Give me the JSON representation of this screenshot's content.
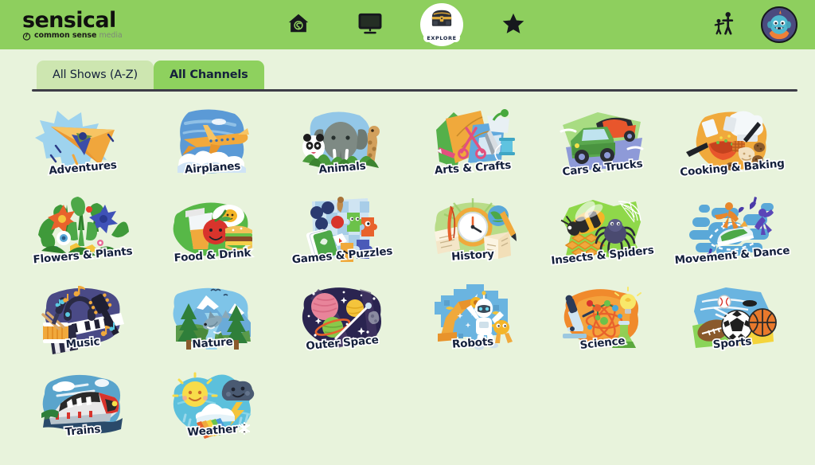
{
  "brand": {
    "name": "sensical",
    "tagline_bold": "common sense",
    "tagline_light": "media",
    "header_bg": "#8ecf5e",
    "page_bg": "#e8f3dc"
  },
  "nav": {
    "items": [
      {
        "id": "home",
        "icon": "home-icon",
        "label": ""
      },
      {
        "id": "watch",
        "icon": "tv-icon",
        "label": ""
      },
      {
        "id": "explore",
        "icon": "treasure-chest-icon",
        "label": "EXPLORE",
        "active": true
      },
      {
        "id": "favorites",
        "icon": "star-icon",
        "label": ""
      }
    ],
    "right": [
      {
        "id": "parents",
        "icon": "parent-child-icon"
      },
      {
        "id": "profile",
        "icon": "avatar-monster-icon"
      }
    ]
  },
  "tabs": [
    {
      "label": "All Shows (A-Z)",
      "active": false
    },
    {
      "label": "All Channels",
      "active": true
    }
  ],
  "channels": [
    {
      "label": "Adventures",
      "art": "adventures"
    },
    {
      "label": "Airplanes",
      "art": "airplanes"
    },
    {
      "label": "Animals",
      "art": "animals"
    },
    {
      "label": "Arts & Crafts",
      "art": "arts-crafts"
    },
    {
      "label": "Cars & Trucks",
      "art": "cars-trucks"
    },
    {
      "label": "Cooking & Baking",
      "art": "cooking-baking"
    },
    {
      "label": "Flowers & Plants",
      "art": "flowers-plants"
    },
    {
      "label": "Food & Drink",
      "art": "food-drink"
    },
    {
      "label": "Games & Puzzles",
      "art": "games-puzzles"
    },
    {
      "label": "History",
      "art": "history"
    },
    {
      "label": "Insects & Spiders",
      "art": "insects-spiders"
    },
    {
      "label": "Movement & Dance",
      "art": "movement-dance"
    },
    {
      "label": "Music",
      "art": "music"
    },
    {
      "label": "Nature",
      "art": "nature"
    },
    {
      "label": "Outer Space",
      "art": "outer-space"
    },
    {
      "label": "Robots",
      "art": "robots"
    },
    {
      "label": "Science",
      "art": "science"
    },
    {
      "label": "Sports",
      "art": "sports"
    },
    {
      "label": "Trains",
      "art": "trains"
    },
    {
      "label": "Weather",
      "art": "weather"
    }
  ]
}
